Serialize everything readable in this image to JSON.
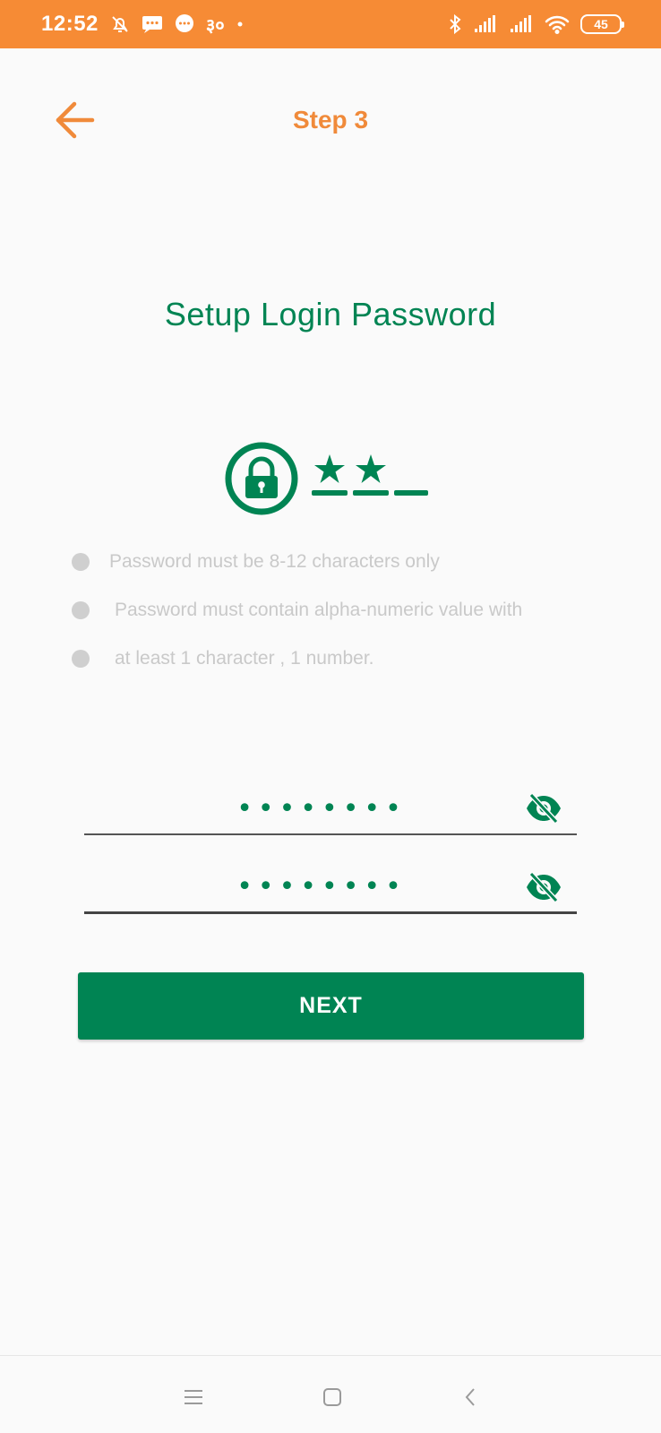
{
  "status_bar": {
    "time": "12:52",
    "extra_text": "३०",
    "battery": "45",
    "background_color": "#f68b35"
  },
  "header": {
    "title": "Step 3",
    "accent_color": "#f08a3a"
  },
  "page": {
    "title": "Setup Login Password",
    "brand_color": "#008453"
  },
  "rules": [
    "Password must be 8-12 characters only",
    "Password must contain alpha-numeric value with",
    "at least 1 character , 1 number."
  ],
  "fields": {
    "password": {
      "value": "••••••••"
    },
    "confirm_password": {
      "value": "••••••••"
    }
  },
  "next_button": {
    "label": "NEXT"
  },
  "icons": {
    "back": "arrow-left-icon",
    "lock": "lock-icon",
    "visibility": "eye-off-icon"
  }
}
